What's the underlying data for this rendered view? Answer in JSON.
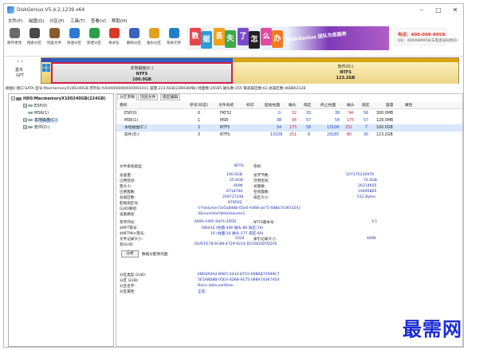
{
  "window": {
    "title": "DiskGenius V5.4.2.1239 x64",
    "minimize": "–",
    "maximize": "□",
    "close": "✕"
  },
  "menu": [
    "文件(F)",
    "磁盘(D)",
    "分区(P)",
    "工具(T)",
    "查看(V)",
    "帮助(H)"
  ],
  "toolbar": [
    {
      "label": "保存更改",
      "icon": "save-icon",
      "color": "#6a6a6a"
    },
    {
      "label": "搜索分区",
      "icon": "search-icon",
      "color": "#4a4a4a"
    },
    {
      "label": "恢复文件",
      "icon": "recover-icon",
      "color": "#8a5a2a"
    },
    {
      "label": "快速分区",
      "icon": "quick-partition-icon",
      "color": "#2f7ad1"
    },
    {
      "label": "新建分区",
      "icon": "new-partition-icon",
      "color": "#2aa04a"
    },
    {
      "label": "格式化",
      "icon": "format-icon",
      "color": "#d83a2a"
    },
    {
      "label": "删除分区",
      "icon": "delete-icon",
      "color": "#3a62c0"
    },
    {
      "label": "备份分区",
      "icon": "backup-icon",
      "color": "#e0a020"
    },
    {
      "label": "系统迁移",
      "icon": "migrate-icon",
      "color": "#1f7fc8"
    }
  ],
  "ad": {
    "tiles": [
      {
        "char": "数",
        "color": "#e5464a"
      },
      {
        "char": "据",
        "color": "#2f9ad6"
      },
      {
        "char": "丢",
        "color": "#f0a01c"
      },
      {
        "char": "失",
        "color": "#3caa4a"
      },
      {
        "char": "了",
        "color": "#7a4cc8"
      },
      {
        "char": "怎",
        "color": "#222222"
      },
      {
        "char": "么",
        "color": "#e24aa0"
      },
      {
        "char": "办",
        "color": "#ef7a24"
      }
    ],
    "slogan": "DiskGenius 团队为您服务",
    "phone": "电话：400-008-9958",
    "qq": "QQ：4000089958(与电话号码相同)"
  },
  "disk_nav": {
    "arrows": "‹ ›",
    "type": "基本",
    "scheme": "GPT"
  },
  "disk_map": {
    "c": {
      "name": "本地磁盘(C:)",
      "fs": "NTFS",
      "size": "100.0GB"
    },
    "d": {
      "name": "软件(D:)",
      "fs": "NTFS",
      "size": "123.2GB"
    }
  },
  "disk_info": "磁盘0 接口:SATA  型号:MacmemoryX100240GB  序列号:AA000000000000001011  容量:223.6GB(228936MB)  柱面数:29185  磁头数:255  每道扇区数:63  总扇区数:468862128",
  "tree": {
    "disk": "HD0:MacmemoryX100240GB(224GB)",
    "items": [
      "ESP(0)",
      "MSR(1)",
      "本地磁盘(C:)",
      "软件(D:)"
    ]
  },
  "tabs": [
    "分区参数",
    "浏览文件",
    "扇区编辑"
  ],
  "partitions": {
    "headers": [
      "卷标",
      "序号(状态)",
      "文件系统",
      "标识",
      "起始柱面",
      "磁头",
      "扇区",
      "终止柱面",
      "磁头",
      "扇区",
      "容量",
      "属性"
    ],
    "rows": [
      [
        "ESP(0)",
        "0",
        "FAT32",
        "",
        "0",
        "32",
        "33",
        "38",
        "94",
        "56",
        "300.0MB",
        ""
      ],
      [
        "MSR(1)",
        "1",
        "MSR",
        "",
        "38",
        "94",
        "57",
        "54",
        "175",
        "57",
        "128.0MB",
        ""
      ],
      [
        "本地磁盘(C:)",
        "2",
        "NTFS",
        "",
        "54",
        "175",
        "58",
        "13108",
        "251",
        "7",
        "100.0GB",
        ""
      ],
      [
        "软件(D:)",
        "3",
        "NTFS",
        "",
        "13108",
        "251",
        "8",
        "29185",
        "80",
        "30",
        "123.2GB",
        ""
      ]
    ]
  },
  "props": {
    "fs_type": {
      "label": "文件系统类型:",
      "value": "NTFS"
    },
    "vol_label": {
      "label": "卷标:",
      "value": ""
    },
    "left": [
      {
        "label": "总容量:",
        "value": "100.0GB"
      },
      {
        "label": "已用空间:",
        "value": "25.6GB"
      },
      {
        "label": "簇大小:",
        "value": "4096"
      },
      {
        "label": "已用簇数:",
        "value": "6718790"
      },
      {
        "label": "总扇区数:",
        "value": "209717248"
      },
      {
        "label": "起始扇区号:",
        "value": "878592"
      }
    ],
    "right": [
      {
        "label": "总字节数:",
        "value": "107375230976"
      },
      {
        "label": "可用空间:",
        "value": "74.4GB"
      },
      {
        "label": "总簇数:",
        "value": "26214655"
      },
      {
        "label": "空闲簇数:",
        "value": "19495865"
      },
      {
        "label": "扇区大小:",
        "value": "512 Bytes"
      }
    ],
    "guid_path": {
      "label": "GUID路径:",
      "value": "\\\\?\\Volume{5e5a8d8b-05e0-4d68-ae75-088a74367a54}"
    },
    "device_path": {
      "label": "设备路径:",
      "value": "\\Device\\HarddiskVolume3"
    },
    "vol_serial": {
      "label": "卷序列号:",
      "value": "669A-F46F-9AF4-3D5D"
    },
    "ntfs_ver": {
      "label": "NTFS版本号:",
      "value": "3.1"
    },
    "mft_cluster": {
      "label": "$MFT簇号:",
      "value": "786432 (柱面:446 磁头:80 扇区:19)"
    },
    "mftmirr_cluster": {
      "label": "$MFTMirr簇号:",
      "value": "16 (柱面:54 磁头:177 扇区:60)"
    },
    "file_record": {
      "label": "文件记录大小:",
      "value": "1024"
    },
    "index_record": {
      "label": "索引记录大小:",
      "value": "4096"
    },
    "vol_guid": {
      "label": "卷GUID:",
      "value": "92ACFE78-6C88-4729-9214-DC04EDD7D2A5"
    },
    "analyze_button": "分析",
    "analyze_note": "数据分配情况图:",
    "type_guid": {
      "label": "分区类型 GUID:",
      "value": "EBD0A0A2-B9E5-4433-87C0-68B6B72699C7"
    },
    "part_guid": {
      "label": "分区 GUID:",
      "value": "5E5A8D8B-05E0-4D68-AE75-088A74367A54"
    },
    "part_name": {
      "label": "分区名字:",
      "value": "Basic data partition"
    },
    "part_attr": {
      "label": "分区属性:",
      "value": "正常"
    }
  },
  "watermark": "最需网"
}
